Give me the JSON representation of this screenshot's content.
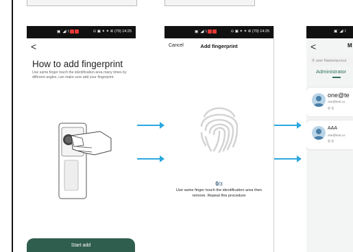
{
  "top_cards": 2,
  "status_bar": {
    "left_icons_1": "▣ ˙◢l ⌇",
    "right_icons": "⊙ ▣ ✦ ✶ ⋐ (70) 14:25"
  },
  "screen1": {
    "back_glyph": "<",
    "title": "How to add fingerprint",
    "description": "Use same finger touch the identification area many times by different angles, can make sure add your fingerprint.",
    "button_label": "Start add"
  },
  "screen2": {
    "cancel_label": "Cancel",
    "title": "Add fingerprint",
    "count_current": "0",
    "count_total": "/3",
    "hint": "Use same finger touch the identification area then remove. Repeat this procedure"
  },
  "screen3": {
    "back_glyph": "<",
    "title_partial": "M",
    "search_placeholder": "user Name/accour",
    "tab_label": "Administrator",
    "users": [
      {
        "name": "one@te",
        "email": "one@test.co",
        "count": "0"
      },
      {
        "name": "AAA",
        "email": "one@test.co",
        "count": "0"
      }
    ]
  },
  "colors": {
    "accent": "#2f5d4e",
    "arrow": "#2aa7df",
    "count": "#1e4d6e"
  }
}
